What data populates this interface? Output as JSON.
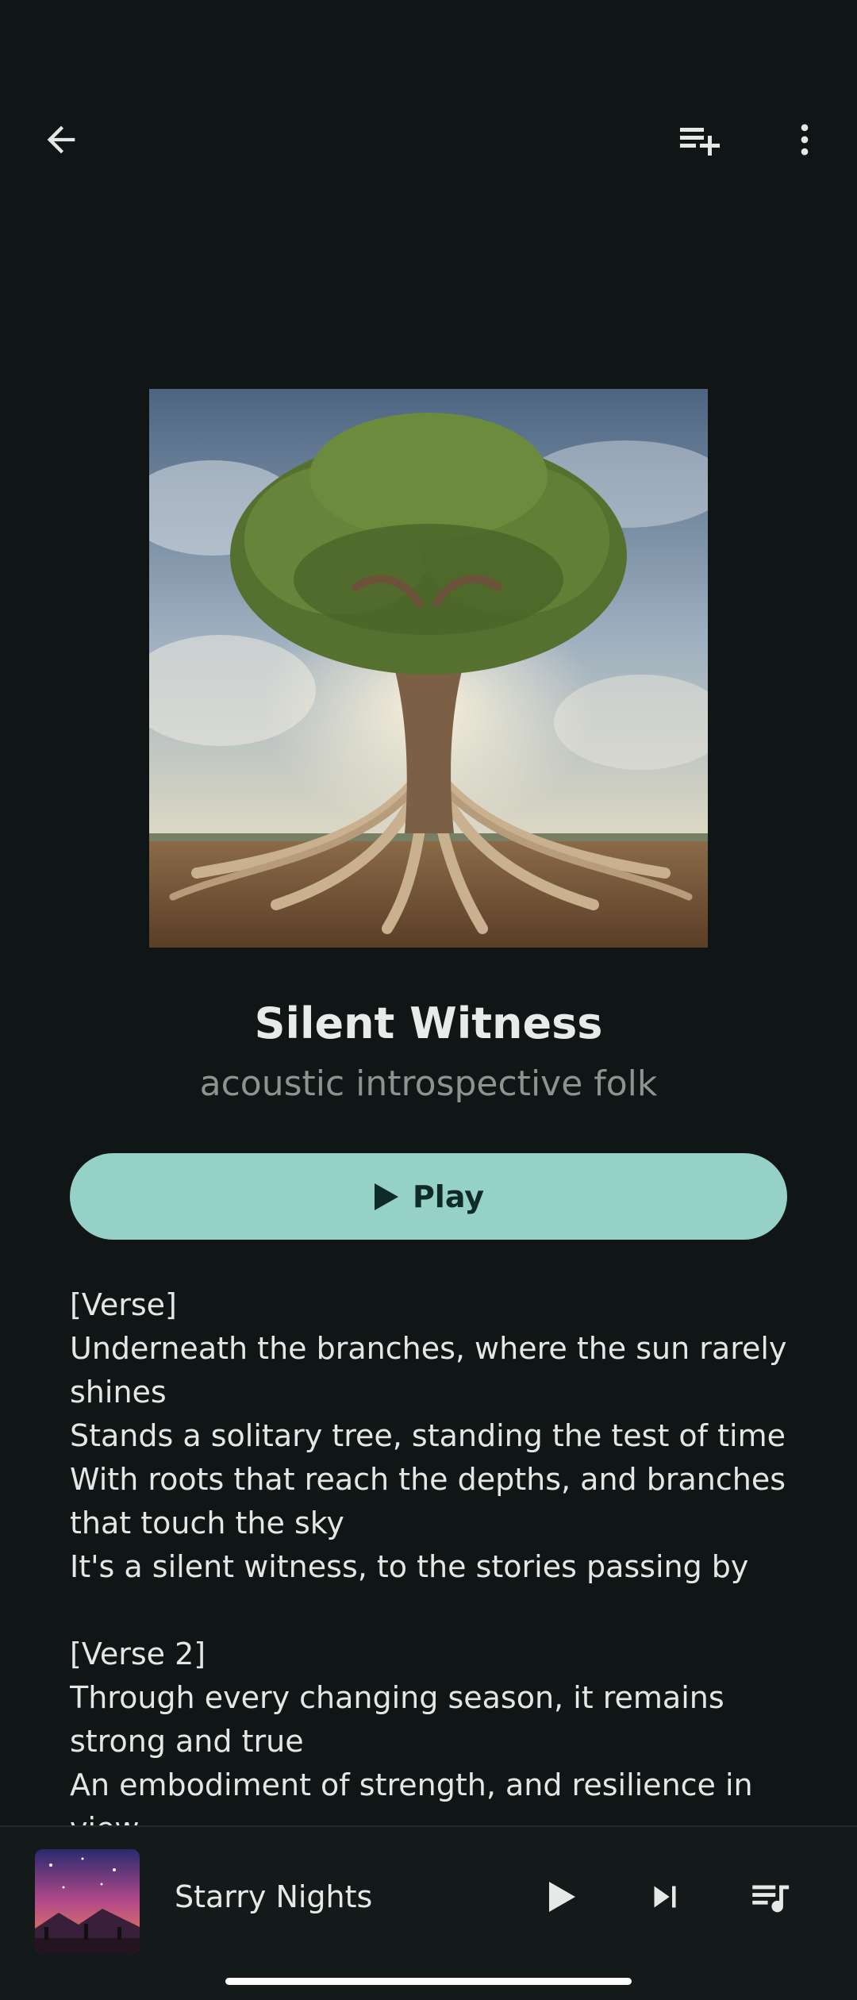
{
  "header": {
    "back_icon": "arrow-left-icon",
    "add_to_queue_icon": "playlist-add-icon",
    "more_icon": "more-vertical-icon"
  },
  "song": {
    "title": "Silent Witness",
    "style": "acoustic introspective folk",
    "artwork_icon": "tree-artwork"
  },
  "play_button": {
    "label": "Play",
    "icon": "play-icon",
    "color": "#96d1c7"
  },
  "lyrics": {
    "verse1_heading": "[Verse]",
    "verse1_line1": "Underneath the branches, where the sun rarely shines",
    "verse1_line2": "Stands a solitary tree, standing the test of time",
    "verse1_line3": "With roots that reach the depths, and branches that touch the sky",
    "verse1_line4": "It's a silent witness, to the stories passing by",
    "verse2_heading": "[Verse 2]",
    "verse2_line1": "Through every changing season, it remains strong and true",
    "verse2_line2": "An embodiment of strength, and resilience in view"
  },
  "mini_player": {
    "title": "Starry Nights",
    "play_icon": "play-icon",
    "next_icon": "skip-next-icon",
    "queue_icon": "queue-music-icon"
  },
  "colors": {
    "background": "#101515",
    "accent": "#96d1c7"
  }
}
